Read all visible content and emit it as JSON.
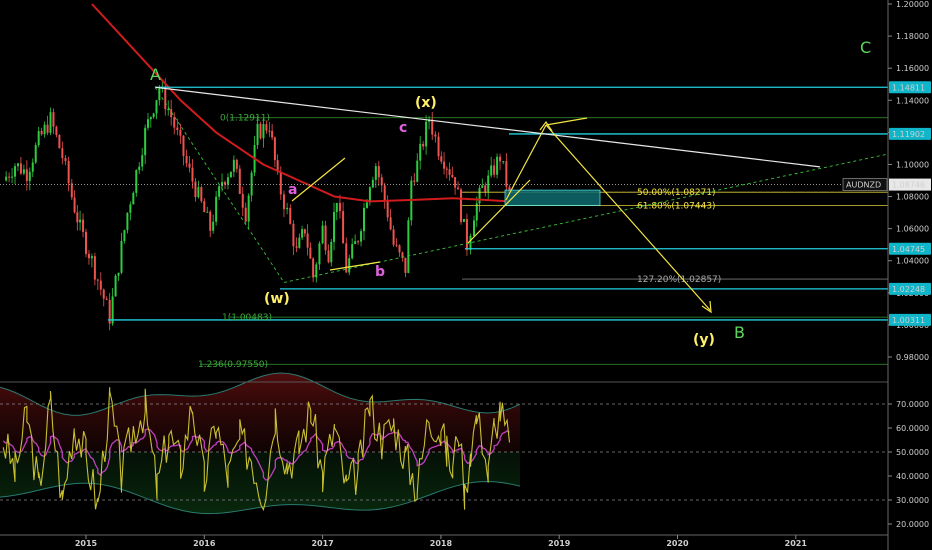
{
  "chart_data": [
    {
      "type": "line",
      "symbol": "AUDNZD",
      "ylim": [
        0.96,
        1.2
      ],
      "y_ticks": [
        "1.20000",
        "1.18000",
        "1.16000",
        "1.14000",
        "1.12000",
        "1.10000",
        "1.08000",
        "1.06000",
        "1.04000",
        "1.02000",
        "1.00000",
        "0.98000"
      ],
      "x_ticks": [
        "2015",
        "2016",
        "2017",
        "2018",
        "2019",
        "2020",
        "2021"
      ],
      "last_price": "1.08746",
      "price_tags": [
        {
          "label": "1.14811",
          "value": 1.14811
        },
        {
          "label": "1.11902",
          "value": 1.11902
        },
        {
          "label": "1.04745",
          "value": 1.04745
        },
        {
          "label": "1.02248",
          "value": 1.02248
        },
        {
          "label": "1.00311",
          "value": 1.00311
        }
      ],
      "fib_levels": [
        {
          "label": "0(1.12911)",
          "value": 1.12911
        },
        {
          "label": "1(1.00483)",
          "value": 1.00483
        },
        {
          "label": "1.236(0.97550)",
          "value": 0.9755
        },
        {
          "label": "50.00%(1.08271)",
          "value": 1.08271
        },
        {
          "label": "61.80%(1.07443)",
          "value": 1.07443
        },
        {
          "label": "127.20%(1.02857)",
          "value": 1.02857
        }
      ],
      "wave_labels": [
        "A",
        "(x)",
        "c",
        "a",
        "b",
        "(w)",
        "(y)",
        "B",
        "C"
      ],
      "series": [
        {
          "values": [
            1.09,
            1.1,
            1.095,
            1.115,
            1.128,
            1.105,
            1.08,
            1.06,
            1.04,
            1.005,
            1.07,
            1.12,
            1.148,
            1.13,
            1.1,
            1.08,
            1.06,
            1.09,
            1.1,
            1.07,
            1.12,
            1.125,
            1.09,
            1.07,
            1.045,
            1.06,
            1.03,
            1.06,
            1.045,
            1.08,
            1.035,
            1.055,
            1.09,
            1.1,
            1.07,
            1.05,
            1.035,
            1.09,
            1.1,
            1.129,
            1.11,
            1.1,
            1.09,
            1.07,
            1.05,
            1.07,
            1.085,
            1.09,
            1.105,
            1.08
          ],
          "x": [
            2014.3,
            2014.4,
            2014.5,
            2014.6,
            2014.7,
            2014.8,
            2014.88,
            2014.95,
            2015.05,
            2015.2,
            2015.35,
            2015.5,
            2015.62,
            2015.72,
            2015.85,
            2015.95,
            2016.05,
            2016.15,
            2016.25,
            2016.35,
            2016.45,
            2016.55,
            2016.62,
            2016.7,
            2016.78,
            2016.85,
            2016.92,
            2017.0,
            2017.05,
            2017.12,
            2017.2,
            2017.3,
            2017.4,
            2017.45,
            2017.55,
            2017.6,
            2017.7,
            2017.75,
            2017.8,
            2017.9,
            2017.98,
            2018.05,
            2018.12,
            2018.17,
            2018.22,
            2018.28,
            2018.35,
            2018.4,
            2018.5,
            2018.58
          ]
        },
        {
          "values": [
            1.2,
            1.18,
            1.16,
            1.14,
            1.12,
            1.1,
            1.09,
            1.08,
            1.077,
            1.078,
            1.079,
            1.078,
            1.077
          ],
          "x": [
            2015.05,
            2015.3,
            2015.55,
            2015.8,
            2016.1,
            2016.5,
            2016.8,
            2017.1,
            2017.4,
            2017.8,
            2018.1,
            2018.35,
            2018.58
          ]
        }
      ]
    },
    {
      "type": "line",
      "ylim": [
        20,
        80
      ],
      "y_ticks": [
        "70.0000",
        "60.0000",
        "50.0000",
        "40.0000",
        "30.0000",
        "20.0000"
      ],
      "series": [
        {
          "values": [
            55,
            42,
            65,
            35,
            70,
            30,
            62,
            48,
            28,
            72,
            40,
            60,
            68,
            35,
            58,
            45,
            70,
            38,
            62,
            40,
            55,
            48,
            30,
            66,
            45,
            52,
            68,
            40,
            60,
            35,
            42,
            70,
            55,
            62,
            48,
            35,
            66,
            58,
            50,
            42,
            60,
            32,
            52,
            64,
            56,
            40,
            60,
            68,
            52
          ],
          "x": [
            2014.3,
            2014.4,
            2014.5,
            2014.6,
            2014.7,
            2014.8,
            2014.9,
            2015.0,
            2015.1,
            2015.2,
            2015.3,
            2015.4,
            2015.5,
            2015.6,
            2015.7,
            2015.8,
            2015.9,
            2016.0,
            2016.1,
            2016.2,
            2016.3,
            2016.4,
            2016.5,
            2016.6,
            2016.7,
            2016.8,
            2016.9,
            2017.0,
            2017.1,
            2017.2,
            2017.3,
            2017.4,
            2017.5,
            2017.6,
            2017.7,
            2017.8,
            2017.9,
            2018.0,
            2018.05,
            2018.1,
            2018.15,
            2018.2,
            2018.25,
            2018.3,
            2018.35,
            2018.4,
            2018.45,
            2018.5,
            2018.58
          ]
        }
      ]
    }
  ],
  "colors": {
    "price_up": "#26a69a",
    "price_green": "#2ecc40",
    "price_down": "#ef5350",
    "ma": "#d01c1c",
    "cyan": "#20d0e0",
    "yellow": "#f4e542",
    "white": "#e8e8e8",
    "fib_green": "#3caa3c",
    "label_green": "#5cd65c",
    "magenta": "#e060e0",
    "rsi": "#c8c030",
    "rsi_ma": "#c040c0",
    "band": "#2a7a70"
  }
}
